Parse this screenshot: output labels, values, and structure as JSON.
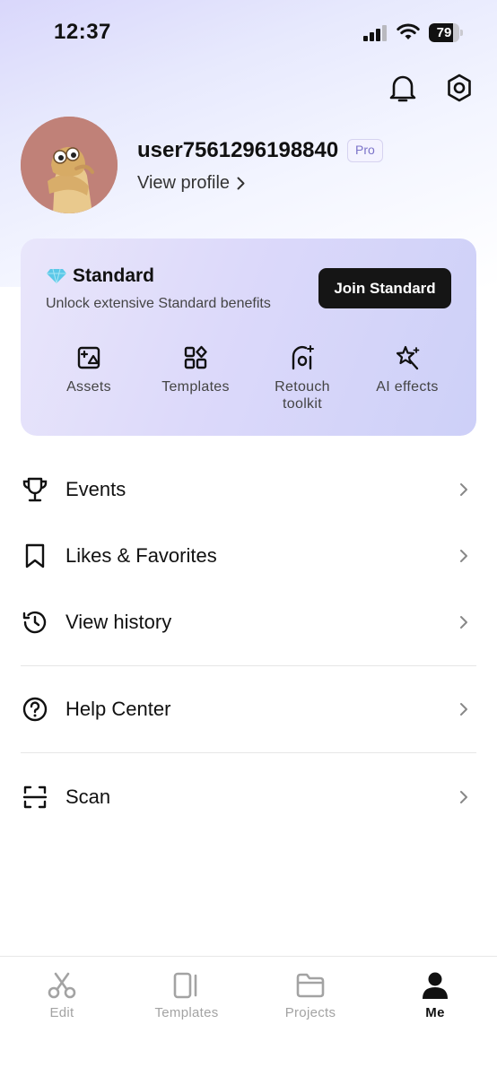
{
  "status_bar": {
    "time": "12:37",
    "battery": "79",
    "battery_level": 0.79
  },
  "header": {
    "notifications_icon": "bell-icon",
    "settings_icon": "gear-icon"
  },
  "profile": {
    "username": "user7561296198840",
    "badge": "Pro",
    "view_profile_label": "View profile"
  },
  "standard_card": {
    "title": "Standard",
    "subtitle": "Unlock extensive Standard benefits",
    "button_label": "Join Standard",
    "accent_color": "#5bc8e8",
    "features": [
      {
        "label": "Assets",
        "icon": "assets-icon"
      },
      {
        "label": "Templates",
        "icon": "templates-icon"
      },
      {
        "label": "Retouch toolkit",
        "icon": "retouch-icon"
      },
      {
        "label": "AI effects",
        "icon": "ai-effects-icon"
      }
    ]
  },
  "menu": {
    "items": [
      {
        "label": "Events",
        "icon": "trophy-icon"
      },
      {
        "label": "Likes & Favorites",
        "icon": "bookmark-icon"
      },
      {
        "label": "View history",
        "icon": "history-icon"
      },
      {
        "label": "Help Center",
        "icon": "help-icon"
      },
      {
        "label": "Scan",
        "icon": "scan-icon"
      }
    ]
  },
  "tab_bar": {
    "tabs": [
      {
        "label": "Edit",
        "icon": "scissors-icon",
        "active": false
      },
      {
        "label": "Templates",
        "icon": "templates-tab-icon",
        "active": false
      },
      {
        "label": "Projects",
        "icon": "folder-icon",
        "active": false
      },
      {
        "label": "Me",
        "icon": "person-icon",
        "active": true
      }
    ]
  }
}
